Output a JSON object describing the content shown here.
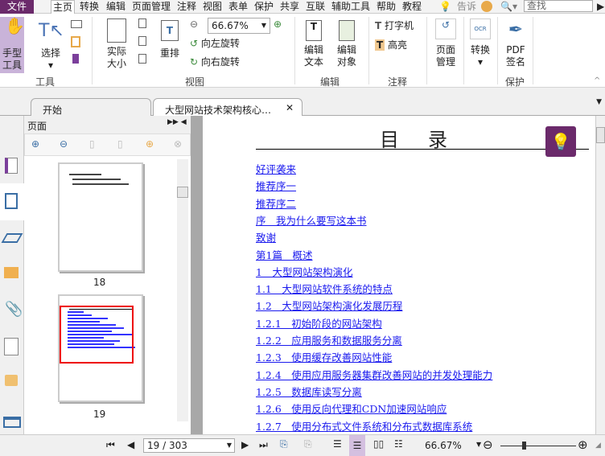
{
  "menu": {
    "file": "文件",
    "items": [
      "主页",
      "转换",
      "编辑",
      "页面管理",
      "注释",
      "视图",
      "表单",
      "保护",
      "共享",
      "互联",
      "辅助工具",
      "帮助",
      "教程"
    ],
    "tell": "告诉",
    "search_placeholder": "查找"
  },
  "ribbon": {
    "tools": {
      "hand": "手型工具",
      "select": "选择",
      "group": "工具"
    },
    "view": {
      "actual": "实际大小",
      "reflow": "重排",
      "zoom": "66.67%",
      "rotate_left": "向左旋转",
      "rotate_right": "向右旋转",
      "group": "视图"
    },
    "edit": {
      "edit_text": "编辑文本",
      "edit_object": "编辑对象",
      "group": "编辑"
    },
    "comment": {
      "typewriter": "打字机",
      "highlight": "高亮",
      "group": "注释"
    },
    "page_manage": "页面管理",
    "convert": "转换",
    "protect": {
      "sign": "PDF签名",
      "group": "保护"
    }
  },
  "tabs": [
    {
      "label": "开始"
    },
    {
      "label": "大型网站技术架构核心…"
    }
  ],
  "panel": {
    "title": "页面",
    "thumbnails": [
      {
        "page": "18"
      },
      {
        "page": "19"
      }
    ]
  },
  "document": {
    "title": "目　录",
    "toc": [
      "好评袭来",
      "推荐序一",
      "推荐序二",
      "序　我为什么要写这本书",
      "致谢",
      "第1篇　概述",
      "1　大型网站架构演化",
      "1.1　大型网站软件系统的特点",
      "1.2　大型网站架构演化发展历程",
      "1.2.1　初始阶段的网站架构",
      "1.2.2　应用服务和数据服务分离",
      "1.2.3　使用缓存改善网站性能",
      "1.2.4　使用应用服务器集群改善网站的并发处理能力",
      "1.2.5　数据库读写分离",
      "1.2.6　使用反向代理和CDN加速网站响应",
      "1.2.7　使用分布式文件系统和分布式数据库系统"
    ]
  },
  "status": {
    "page": "19 / 303",
    "zoom": "66.67%",
    "zoom_level_percent": 66.67
  },
  "colors": {
    "brand": "#6b2a6b",
    "link": "#1a1aee",
    "active_tool": "#c9b3d9"
  }
}
